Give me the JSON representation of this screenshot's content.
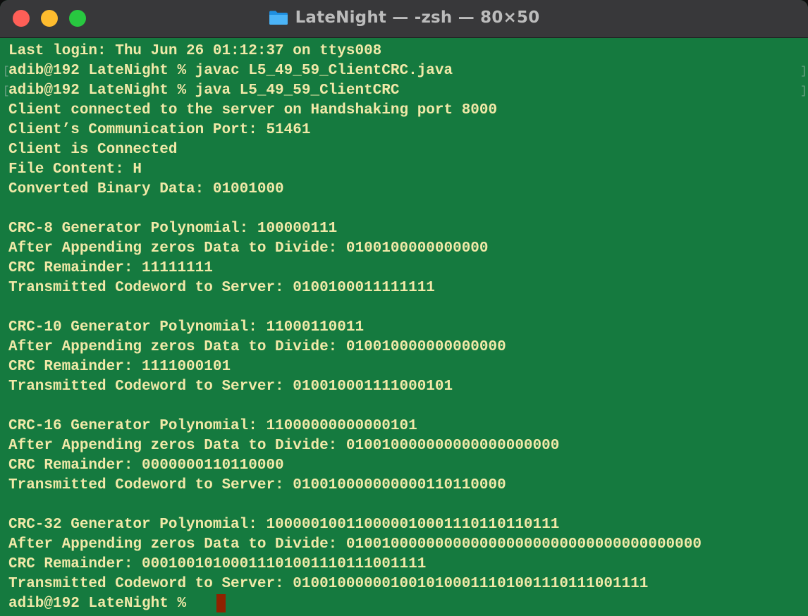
{
  "window": {
    "title": "LateNight — -zsh — 80×50",
    "folder_icon": "folder-icon",
    "colors": {
      "terminal_background": "#157a3f",
      "text": "#f1e9a8",
      "cursor": "#8f2200",
      "titlebar": "#38383a"
    }
  },
  "terminal": {
    "lines": [
      "Last login: Thu Jun 26 01:12:37 on ttys008",
      "adib@192 LateNight % javac L5_49_59_ClientCRC.java",
      "adib@192 LateNight % java L5_49_59_ClientCRC",
      "Client connected to the server on Handshaking port 8000",
      "Client’s Communication Port: 51461",
      "Client is Connected",
      "File Content: H",
      "Converted Binary Data: 01001000",
      "",
      "CRC-8 Generator Polynomial: 100000111",
      "After Appending zeros Data to Divide: 0100100000000000",
      "CRC Remainder: 11111111",
      "Transmitted Codeword to Server: 0100100011111111",
      "",
      "CRC-10 Generator Polynomial: 11000110011",
      "After Appending zeros Data to Divide: 010010000000000000",
      "CRC Remainder: 1111000101",
      "Transmitted Codeword to Server: 010010001111000101",
      "",
      "CRC-16 Generator Polynomial: 11000000000000101",
      "After Appending zeros Data to Divide: 010010000000000000000000",
      "CRC Remainder: 0000000110110000",
      "Transmitted Codeword to Server: 010010000000000110110000",
      "",
      "CRC-32 Generator Polynomial: 100000100110000010001110110110111",
      "After Appending zeros Data to Divide: 0100100000000000000000000000000000000000",
      "CRC Remainder: 00010010100011101001110111001111",
      "Transmitted Codeword to Server: 0100100000010010100011101001110111001111",
      "adib@192 LateNight % "
    ]
  }
}
